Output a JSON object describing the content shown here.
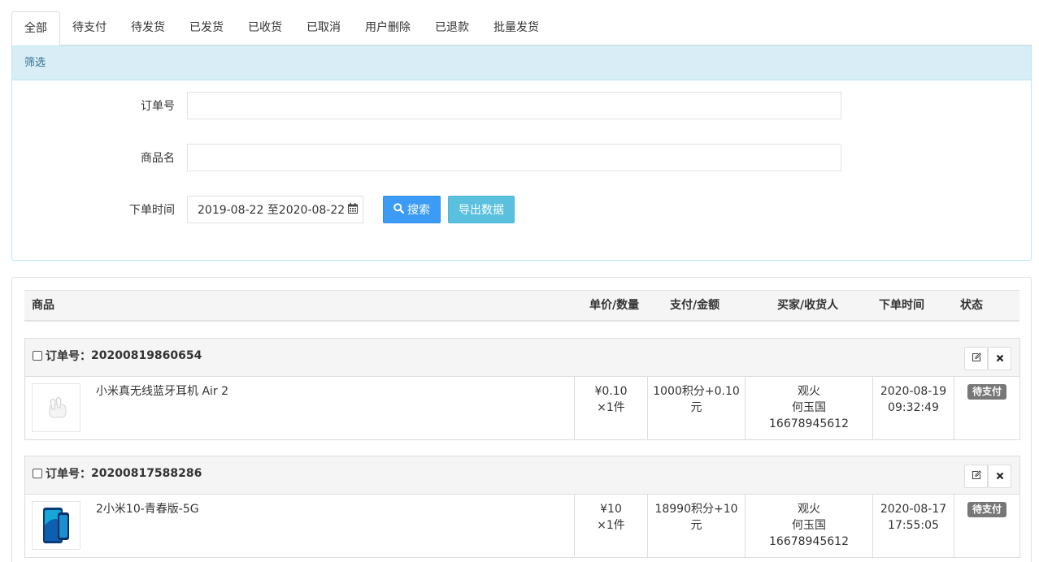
{
  "tabs": [
    {
      "label": "全部"
    },
    {
      "label": "待支付"
    },
    {
      "label": "待发货"
    },
    {
      "label": "已发货"
    },
    {
      "label": "已收货"
    },
    {
      "label": "已取消"
    },
    {
      "label": "用户删除"
    },
    {
      "label": "已退款"
    },
    {
      "label": "批量发货"
    }
  ],
  "filter": {
    "heading": "筛选",
    "order_no_label": "订单号",
    "order_no_value": "",
    "product_label": "商品名",
    "product_value": "",
    "time_label": "下单时间",
    "time_value": "2019-08-22 至2020-08-22",
    "search_label": "搜索",
    "export_label": "导出数据"
  },
  "table": {
    "headers": {
      "product": "商品",
      "price_qty": "单价/数量",
      "payment": "支付/金额",
      "buyer": "买家/收货人",
      "time": "下单时间",
      "status": "状态"
    }
  },
  "orders": [
    {
      "order_no_prefix": "订单号：",
      "order_no": "20200819860654",
      "product_name": "小米真无线蓝牙耳机 Air 2",
      "price": "¥0.10",
      "qty": "×1件",
      "payment_line1": "1000积分+0.10",
      "payment_line2": "元",
      "buyer": "观火",
      "receiver": "何玉国",
      "phone": "16678945612",
      "date": "2020-08-19",
      "time": "09:32:49",
      "status": "待支付"
    },
    {
      "order_no_prefix": "订单号：",
      "order_no": "20200817588286",
      "product_name": "2小米10-青春版-5G",
      "price": "¥10",
      "qty": "×1件",
      "payment_line1": "18990积分+10",
      "payment_line2": "元",
      "buyer": "观火",
      "receiver": "何玉国",
      "phone": "16678945612",
      "date": "2020-08-17",
      "time": "17:55:05",
      "status": "待支付"
    }
  ],
  "colors": {
    "info_bg": "#d9edf7",
    "info_border": "#bce8f1",
    "info_text": "#31708f",
    "primary": "#3c9cf5",
    "export": "#5bc0de",
    "badge": "#777777"
  },
  "icons": {
    "search": "search-icon",
    "calendar": "calendar-icon",
    "edit": "edit-icon",
    "delete": "close-icon"
  }
}
